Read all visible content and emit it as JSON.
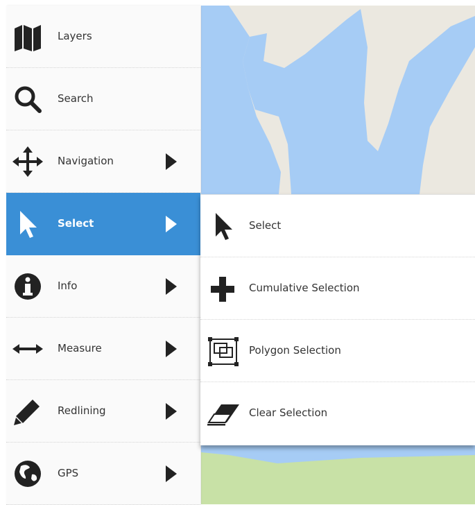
{
  "colors": {
    "active_bg": "#3a8fd6",
    "water": "#a6ccf5",
    "land": "#ebe8e0",
    "park": "#c8e1a6",
    "icon": "#222222"
  },
  "menu": {
    "items": [
      {
        "label": "Layers",
        "icon": "map-icon",
        "arrow": false
      },
      {
        "label": "Search",
        "icon": "search-icon",
        "arrow": false
      },
      {
        "label": "Navigation",
        "icon": "move-arrows-icon",
        "arrow": true
      },
      {
        "label": "Select",
        "icon": "cursor-pointer-icon",
        "arrow": true,
        "active": true
      },
      {
        "label": "Info",
        "icon": "info-circle-icon",
        "arrow": true
      },
      {
        "label": "Measure",
        "icon": "horizontal-arrows-icon",
        "arrow": true
      },
      {
        "label": "Redlining",
        "icon": "pencil-icon",
        "arrow": true
      },
      {
        "label": "GPS",
        "icon": "globe-icon",
        "arrow": true
      }
    ]
  },
  "submenu": {
    "items": [
      {
        "label": "Select",
        "icon": "cursor-pointer-icon"
      },
      {
        "label": "Cumulative Selection",
        "icon": "plus-icon"
      },
      {
        "label": "Polygon Selection",
        "icon": "polygon-selection-icon"
      },
      {
        "label": "Clear Selection",
        "icon": "eraser-icon"
      }
    ]
  }
}
